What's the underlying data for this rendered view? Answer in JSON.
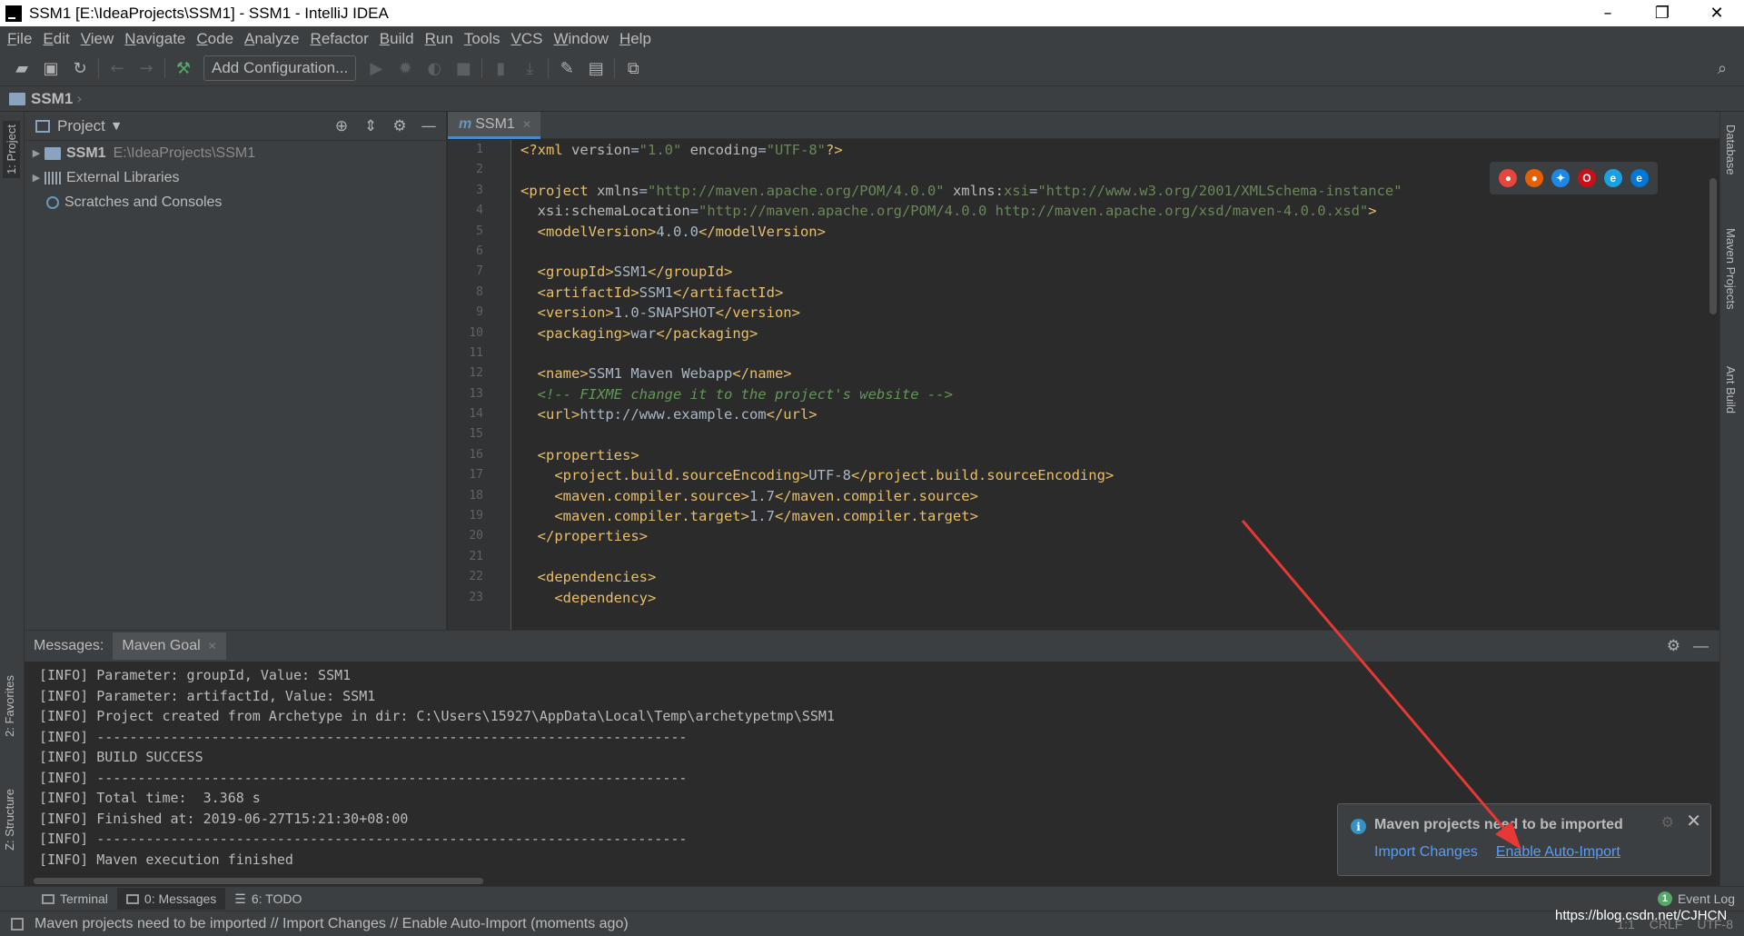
{
  "window": {
    "title": "SSM1 [E:\\IdeaProjects\\SSM1] - SSM1 - IntelliJ IDEA",
    "controls": [
      "–",
      "❐",
      "✕"
    ]
  },
  "menu": [
    "File",
    "Edit",
    "View",
    "Navigate",
    "Code",
    "Analyze",
    "Refactor",
    "Build",
    "Run",
    "Tools",
    "VCS",
    "Window",
    "Help"
  ],
  "toolbar": {
    "add_configuration": "Add Configuration..."
  },
  "navbar": {
    "crumb": "SSM1"
  },
  "left_tool_tabs": {
    "project": "1: Project",
    "favorites": "2: Favorites",
    "structure": "Z: Structure"
  },
  "right_tool_tabs": {
    "database": "Database",
    "maven": "Maven Projects",
    "ant": "Ant Build"
  },
  "project_panel": {
    "title": "Project",
    "tree": [
      {
        "name": "SSM1",
        "path": "E:\\IdeaProjects\\SSM1"
      },
      {
        "name": "External Libraries"
      },
      {
        "name": "Scratches and Consoles"
      }
    ]
  },
  "editor": {
    "tab": {
      "icon": "m",
      "label": "SSM1"
    },
    "browsers": [
      "chrome-icon",
      "firefox-icon",
      "safari-icon",
      "opera-icon",
      "ie-icon",
      "edge-icon"
    ],
    "code": [
      [
        [
          "t",
          "<?xml "
        ],
        [
          "a",
          "version"
        ],
        [
          "tx",
          "="
        ],
        [
          "v",
          "\"1.0\""
        ],
        [
          "a",
          " encoding"
        ],
        [
          "tx",
          "="
        ],
        [
          "v",
          "\"UTF-8\""
        ],
        [
          "t",
          "?>"
        ]
      ],
      [],
      [
        [
          "t",
          "<project "
        ],
        [
          "a",
          "xmlns"
        ],
        [
          "tx",
          "="
        ],
        [
          "v",
          "\"http://maven.apache.org/POM/4.0.0\""
        ],
        [
          "a",
          " xmlns:"
        ],
        [
          "v",
          "xsi"
        ],
        [
          "tx",
          "="
        ],
        [
          "v",
          "\"http://www.w3.org/2001/XMLSchema-instance\""
        ]
      ],
      [
        [
          "a",
          "  xsi"
        ],
        [
          "tx",
          ":"
        ],
        [
          "a",
          "schemaLocation"
        ],
        [
          "tx",
          "="
        ],
        [
          "v",
          "\"http://maven.apache.org/POM/4.0.0 http://maven.apache.org/xsd/maven-4.0.0.xsd\""
        ],
        [
          "t",
          ">"
        ]
      ],
      [
        [
          "t",
          "  <modelVersion>"
        ],
        [
          "tx",
          "4.0.0"
        ],
        [
          "t",
          "</modelVersion>"
        ]
      ],
      [],
      [
        [
          "t",
          "  <groupId>"
        ],
        [
          "tx",
          "SSM1"
        ],
        [
          "t",
          "</groupId>"
        ]
      ],
      [
        [
          "t",
          "  <artifactId>"
        ],
        [
          "tx",
          "SSM1"
        ],
        [
          "t",
          "</artifactId>"
        ]
      ],
      [
        [
          "t",
          "  <version>"
        ],
        [
          "tx",
          "1.0-SNAPSHOT"
        ],
        [
          "t",
          "</version>"
        ]
      ],
      [
        [
          "t",
          "  <packaging>"
        ],
        [
          "tx",
          "war"
        ],
        [
          "t",
          "</packaging>"
        ]
      ],
      [],
      [
        [
          "t",
          "  <name>"
        ],
        [
          "tx",
          "SSM1 Maven Webapp"
        ],
        [
          "t",
          "</name>"
        ]
      ],
      [
        [
          "c",
          "  <!-- FIXME change it to the project's website -->"
        ]
      ],
      [
        [
          "t",
          "  <url>"
        ],
        [
          "tx",
          "http://www.example.com"
        ],
        [
          "t",
          "</url>"
        ]
      ],
      [],
      [
        [
          "t",
          "  <properties>"
        ]
      ],
      [
        [
          "t",
          "    <project.build.sourceEncoding>"
        ],
        [
          "tx",
          "UTF-8"
        ],
        [
          "t",
          "</project.build.sourceEncoding>"
        ]
      ],
      [
        [
          "t",
          "    <maven.compiler.source>"
        ],
        [
          "tx",
          "1.7"
        ],
        [
          "t",
          "</maven.compiler.source>"
        ]
      ],
      [
        [
          "t",
          "    <maven.compiler.target>"
        ],
        [
          "tx",
          "1.7"
        ],
        [
          "t",
          "</maven.compiler.target>"
        ]
      ],
      [
        [
          "t",
          "  </properties>"
        ]
      ],
      [],
      [
        [
          "t",
          "  <dependencies>"
        ]
      ],
      [
        [
          "t",
          "    <dependency>"
        ]
      ]
    ]
  },
  "messages": {
    "title": "Messages:",
    "tab": "Maven Goal",
    "lines": [
      "[INFO] Parameter: groupId, Value: SSM1",
      "[INFO] Parameter: artifactId, Value: SSM1",
      "[INFO] Project created from Archetype in dir: C:\\Users\\15927\\AppData\\Local\\Temp\\archetypetmp\\SSM1",
      "[INFO] ------------------------------------------------------------------------",
      "[INFO] BUILD SUCCESS",
      "[INFO] ------------------------------------------------------------------------",
      "[INFO] Total time:  3.368 s",
      "[INFO] Finished at: 2019-06-27T15:21:30+08:00",
      "[INFO] ------------------------------------------------------------------------",
      "[INFO] Maven execution finished"
    ]
  },
  "notification": {
    "title": "Maven projects need to be imported",
    "import_changes": "Import Changes",
    "enable_auto_import": "Enable Auto-Import"
  },
  "bottom_tabs": {
    "terminal": "Terminal",
    "messages": "0: Messages",
    "todo": "6: TODO",
    "event_log": "Event Log",
    "event_count": "1"
  },
  "status": {
    "message": "Maven projects need to be imported // Import Changes // Enable Auto-Import (moments ago)",
    "position": "1:1",
    "line_sep": "CRLF",
    "encoding": "UTF-8"
  },
  "watermark": "https://blog.csdn.net/CJHCN",
  "annotation_color": "#e53935"
}
